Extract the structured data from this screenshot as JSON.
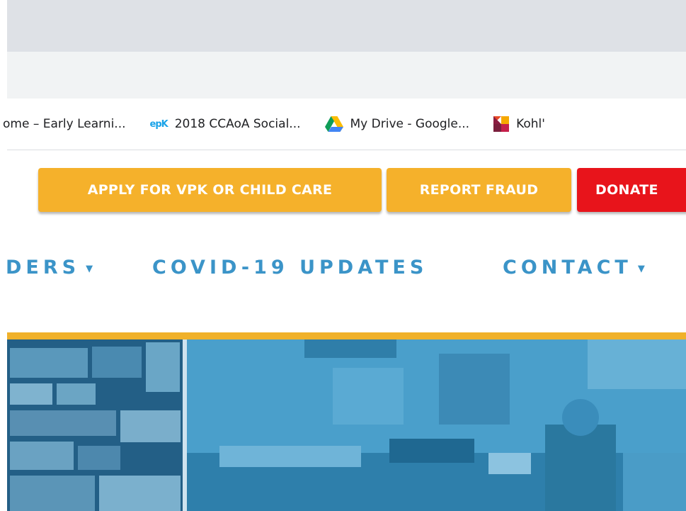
{
  "bookmarks": [
    {
      "label": "ome – Early Learni...",
      "icon": "page-icon"
    },
    {
      "label": "2018 CCAoA Social...",
      "icon": "epk-icon",
      "icon_text": "epK"
    },
    {
      "label": "My Drive - Google...",
      "icon": "google-drive-icon"
    },
    {
      "label": "Kohl'",
      "icon": "kohls-icon"
    }
  ],
  "header_buttons": {
    "apply": "APPLY FOR VPK OR CHILD CARE",
    "fraud": "REPORT FRAUD",
    "donate": "DONATE"
  },
  "nav": {
    "providers": "DERS",
    "covid": "COVID-19 UPDATES",
    "contact": "CONTACT",
    "caret": "▼"
  },
  "colors": {
    "accent_gold": "#f5b12b",
    "donate_red": "#e8141b",
    "nav_blue": "#3b94c8",
    "hero_blue": "#2d8fbf"
  }
}
